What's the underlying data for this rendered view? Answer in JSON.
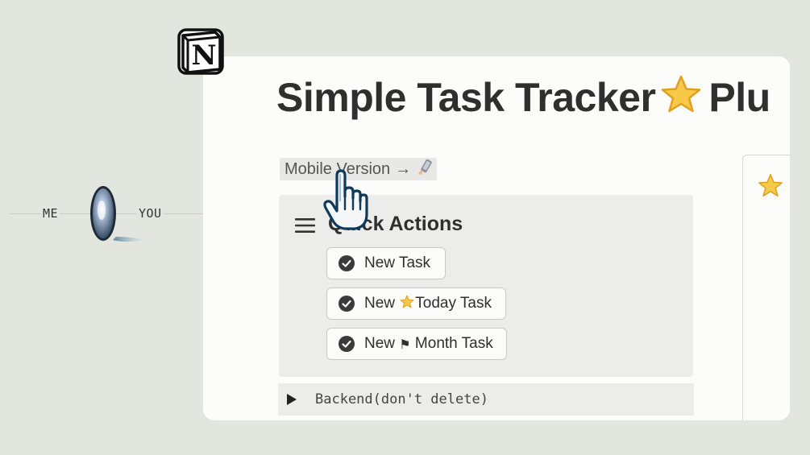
{
  "left_illustration": {
    "left_label": "ME",
    "right_label": "YOU",
    "coin_icon": "spinning-coin-icon"
  },
  "logo": {
    "icon": "notion-logo-icon",
    "letter": "N"
  },
  "page": {
    "title": "Simple Task Tracker",
    "title_tail": "Plu",
    "title_icon": "star-emoji-icon",
    "mobile_link": {
      "label": "Mobile Version",
      "arrow": "→",
      "icon": "phone-emoji-icon"
    },
    "quick_actions": {
      "menu_icon": "hamburger-menu-icon",
      "title": "Quick Actions",
      "buttons": [
        {
          "label": "New Task",
          "icon": "check-circle-icon"
        },
        {
          "label_prefix": "New ",
          "emoji": "⭐",
          "label_suffix": "Today Task",
          "icon": "check-circle-icon"
        },
        {
          "label_prefix": "New ",
          "emoji": "⚑",
          "label_suffix": " Month Task",
          "icon": "check-circle-icon"
        }
      ]
    },
    "toggle": {
      "icon": "toggle-triangle-icon",
      "label": "Backend(don't delete)"
    },
    "side_panel": {
      "icon": "star-emoji-icon"
    }
  },
  "cursor": {
    "icon": "hand-pointer-icon"
  },
  "colors": {
    "background": "#e3e6df",
    "card": "#fcfcfb",
    "quick_box": "#ececeb",
    "text": "#2f2f2f",
    "star": "#f5c242"
  }
}
